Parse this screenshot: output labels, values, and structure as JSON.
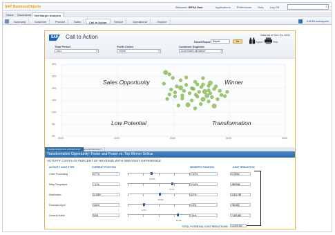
{
  "app": {
    "logo": "SAP BusinessObjects",
    "welcome_prefix": "Welcome:",
    "user": "BPSA User",
    "links": [
      "Applications",
      "Preferences",
      "Help",
      "Log Off"
    ]
  },
  "doc_tabs": [
    {
      "label": "Home"
    },
    {
      "label": "Documents"
    },
    {
      "label": "Net Margin Analysis"
    }
  ],
  "toolbar": {
    "tabs": [
      "Summary",
      "Customer",
      "Product",
      "Sales",
      "Call to Action",
      "Service",
      "Operational",
      "Explore"
    ],
    "active": "Call to Action",
    "edit_workspace": "Edit BI workspace"
  },
  "dashboard": {
    "logo_text": "SAP",
    "title": "Call to Action",
    "date_label": "Data as of Dec 31, 2011",
    "detail_reports_label": "Detail Reports",
    "detail_reports_value": "Report",
    "go_label": "Go",
    "export_label": "Export",
    "print_label": "Print",
    "filters": [
      {
        "label": "Time Period",
        "value": "2011"
      },
      {
        "label": "Profit Center",
        "value": "C0008"
      },
      {
        "label": "Customer Segment",
        "value": "CUSTOMER SEGMENT"
      }
    ]
  },
  "chart_data": {
    "type": "scatter",
    "quadrant_labels": [
      "Sales Opportunity",
      "Winner",
      "Low Potential",
      "Transformation"
    ],
    "x_ticks": [
      "00.00",
      "10.00",
      "20.00",
      "30.00",
      "40.00"
    ],
    "y_ticks": [
      "30%",
      "25%",
      "20%",
      "15%",
      "10%",
      "5%",
      "0%"
    ],
    "xlim": [
      0,
      40
    ],
    "ylim": [
      0,
      30
    ],
    "accent": "#7cb740",
    "points": [
      [
        18.6,
        26.6
      ],
      [
        19.3,
        25.8
      ],
      [
        19.9,
        24.3
      ],
      [
        21.3,
        23.3
      ],
      [
        23.9,
        22.7
      ],
      [
        25.3,
        21.6
      ],
      [
        26.3,
        21.0
      ],
      [
        26.6,
        22.2
      ],
      [
        25.0,
        20.5
      ],
      [
        26.3,
        19.1
      ],
      [
        24.6,
        18.5
      ],
      [
        23.6,
        19.7
      ],
      [
        22.9,
        17.9
      ],
      [
        21.9,
        18.9
      ],
      [
        21.3,
        20.2
      ],
      [
        20.3,
        18.3
      ],
      [
        19.6,
        19.5
      ],
      [
        20.6,
        20.8
      ],
      [
        22.3,
        21.4
      ],
      [
        23.3,
        20.0
      ],
      [
        24.3,
        21.6
      ],
      [
        25.6,
        18.6
      ],
      [
        26.6,
        17.9
      ],
      [
        27.3,
        19.7
      ],
      [
        27.6,
        20.8
      ],
      [
        28.3,
        18.9
      ],
      [
        28.6,
        17.2
      ],
      [
        26.9,
        16.3
      ],
      [
        25.3,
        15.4
      ],
      [
        24.3,
        16.5
      ],
      [
        23.3,
        14.9
      ],
      [
        21.6,
        15.7
      ],
      [
        20.3,
        16.6
      ],
      [
        19.3,
        17.4
      ],
      [
        18.9,
        15.5
      ],
      [
        22.6,
        13.1
      ],
      [
        24.9,
        13.4
      ],
      [
        26.3,
        14.5
      ],
      [
        27.9,
        15.4
      ],
      [
        29.2,
        16.7
      ],
      [
        20.9,
        12.8
      ],
      [
        23.9,
        11.6
      ],
      [
        27.3,
        12.6
      ],
      [
        18.3,
        21.9
      ],
      [
        29.6,
        18.5
      ],
      [
        22.3,
        24.5
      ],
      [
        25.3,
        24.2
      ],
      [
        24.0,
        17.3
      ],
      [
        21.6,
        17.0
      ],
      [
        26.0,
        16.9
      ]
    ]
  },
  "panel": {
    "tabs": [
      "TRANSFORMATION OPPORTUNITY",
      "SALES OPPORTUNITY"
    ],
    "title": "Transformation Opportunity: Foster and Foster vs. Top Winner Sellcar",
    "subtitle": "ACTIVITY COSTS AS PERCENT OF REVENUE WITH GREATEST DIFFERENCE",
    "col_headers": [
      "ACTIVITY COST TYPE",
      "CURRENT POSITION",
      "WINNER'S POSITION",
      "COST REDUCTION"
    ],
    "rows": [
      {
        "label": "Order Processing",
        "current": "9.77%",
        "winner": "7.62%",
        "cost": "5.78054",
        "mid": "12.5%",
        "knob": 0.38
      },
      {
        "label": "Mktg Campaigns",
        "current": "7.11%",
        "winner": "2.04%",
        "cost": "4562568",
        "mid": "8.7%",
        "knob": 0.72
      },
      {
        "label": "Distribution",
        "current": "11.08%",
        "winner": "8.7%",
        "cost": "4,051,785",
        "mid": "13.6%",
        "knob": 0.52
      },
      {
        "label": "Financial Mgmt",
        "current": "3.64%",
        "winner": "2.5%",
        "cost": "785,885",
        "mid": "4.8%",
        "knob": 0.25
      },
      {
        "label": "General Admin",
        "current": "8.5%",
        "winner": "3.4%",
        "cost": "7,399,882",
        "mid": "10.3%",
        "knob": 0.82
      }
    ],
    "total_label": "TOTAL POTENTIAL COST REDUCTIONS",
    "total_value": "14,000,000"
  }
}
